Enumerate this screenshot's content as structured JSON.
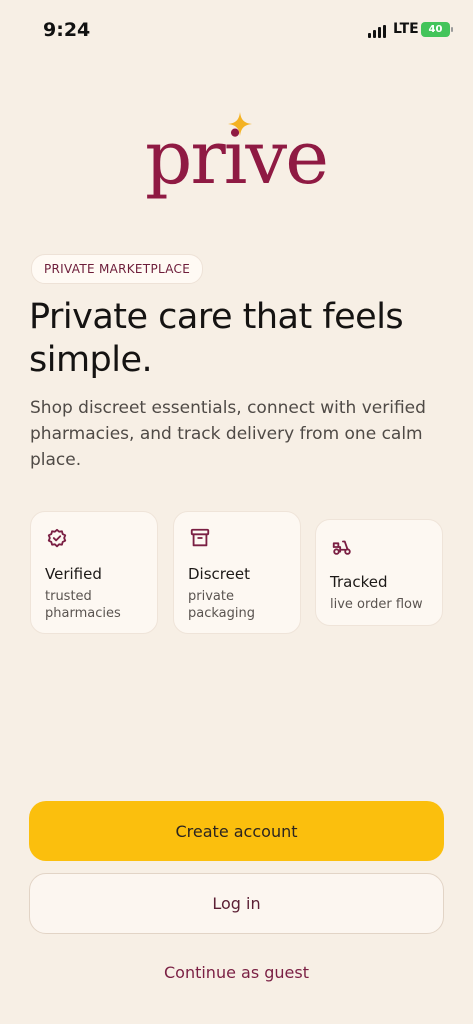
{
  "status_bar": {
    "time": "9:24",
    "network": "LTE",
    "battery": "40"
  },
  "brand": {
    "name": "prive",
    "accent_color": "#8f1a43",
    "sparkle_color": "#f4b223"
  },
  "hero": {
    "badge": "PRIVATE MARKETPLACE",
    "headline": "Private care that feels simple.",
    "subtext": "Shop discreet essentials, connect with verified pharmacies, and track delivery from one calm place."
  },
  "features": [
    {
      "icon": "verified-badge-icon",
      "title": "Verified",
      "subtitle": "trusted pharmacies"
    },
    {
      "icon": "archive-box-icon",
      "title": "Discreet",
      "subtitle": "private packaging"
    },
    {
      "icon": "scooter-icon",
      "title": "Tracked",
      "subtitle": "live order flow"
    }
  ],
  "actions": {
    "create_account": "Create account",
    "log_in": "Log in",
    "continue_guest": "Continue as guest"
  },
  "colors": {
    "background": "#f7efe5",
    "primary_button": "#fbbf0d"
  }
}
